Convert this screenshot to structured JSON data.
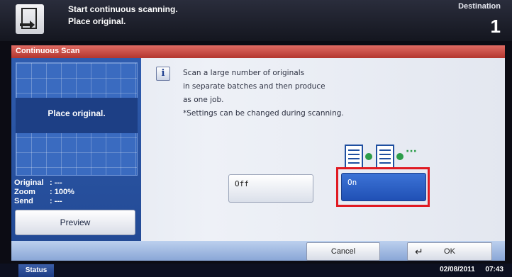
{
  "header": {
    "message_line1": "Start continuous scanning.",
    "message_line2": "Place original.",
    "destination_label": "Destination",
    "destination_count": "1"
  },
  "panel_title": "Continuous Scan",
  "preview_area": {
    "placeholder": "Place original.",
    "info": [
      {
        "label": "Original",
        "value": ": ---"
      },
      {
        "label": "Zoom",
        "value": ": 100%"
      },
      {
        "label": "Send",
        "value": ": ---"
      }
    ],
    "preview_button": "Preview"
  },
  "description": {
    "lines": [
      "Scan a large number of originals",
      "in separate batches and then produce",
      "as one job.",
      "*Settings can be changed during scanning."
    ]
  },
  "options": {
    "off_label": "Off",
    "on_label": "On",
    "selected": "On",
    "illustration_ellipsis": "···"
  },
  "actions": {
    "cancel_label": "Cancel",
    "ok_label": "OK"
  },
  "statusbar": {
    "status_label": "Status",
    "date": "02/08/2011",
    "time": "07:43"
  },
  "colors": {
    "title_bar": "#c0433b",
    "selected_button": "#2a5cc5",
    "highlight_border": "#e01a22"
  }
}
